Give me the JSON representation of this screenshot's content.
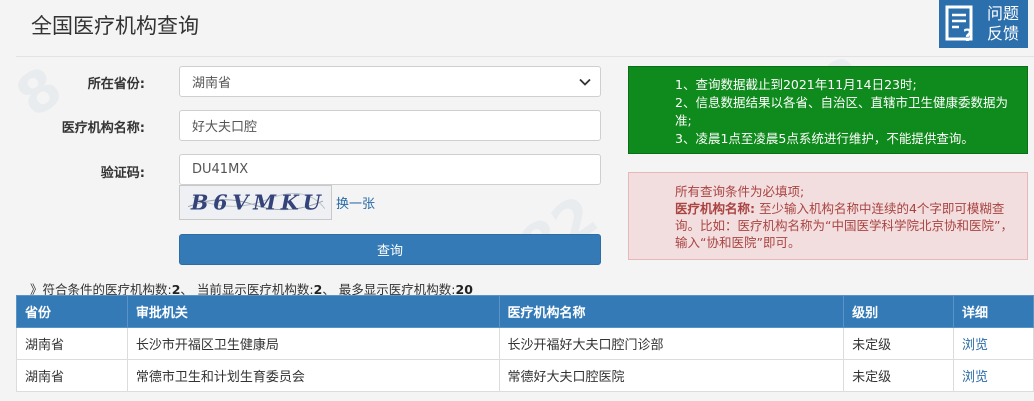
{
  "header": {
    "title": "全国医疗机构查询",
    "feedback_label_line1": "问题",
    "feedback_label_line2": "反馈"
  },
  "form": {
    "province_label": "所在省份:",
    "province_value": "湖南省",
    "name_label": "医疗机构名称:",
    "name_value": "好大夫口腔",
    "captcha_label": "验证码:",
    "captcha_value": "DU41MX",
    "captcha_image_text": "B6VMKU",
    "refresh_link": "换一张",
    "submit_label": "查询"
  },
  "notices": {
    "green": [
      "1、查询数据截止到2021年11月14日23时;",
      "2、信息数据结果以各省、自治区、直辖市卫生健康委数据为准;",
      "3、凌晨1点至凌晨5点系统进行维护，不能提供查询。"
    ],
    "red_line1": "所有查询条件为必填项;",
    "red_bold": "医疗机构名称:",
    "red_rest": " 至少输入机构名称中连续的4个字即可模糊查询。比如：医疗机构名称为“中国医学科学院北京协和医院”，输入“协和医院”即可。"
  },
  "summary": {
    "prefix": "》符合条件的医疗机构数:",
    "matched_count": "2",
    "sep1": "、 当前显示医疗机构数:",
    "shown_count": "2",
    "sep2": "、 最多显示医疗机构数:",
    "max_count": "20"
  },
  "table": {
    "headers": [
      "省份",
      "审批机关",
      "医疗机构名称",
      "级别",
      "详细"
    ],
    "rows": [
      [
        "湖南省",
        "长沙市开福区卫生健康局",
        "长沙开福好大夫口腔门诊部",
        "未定级",
        "浏览"
      ],
      [
        "湖南省",
        "常德市卫生和计划生育委员会",
        "常德好大夫口腔医院",
        "未定级",
        "浏览"
      ]
    ]
  },
  "colors": {
    "primary": "#337ab7",
    "success": "#0f8a1c",
    "danger_bg": "#f2dede",
    "danger_text": "#a94442"
  }
}
